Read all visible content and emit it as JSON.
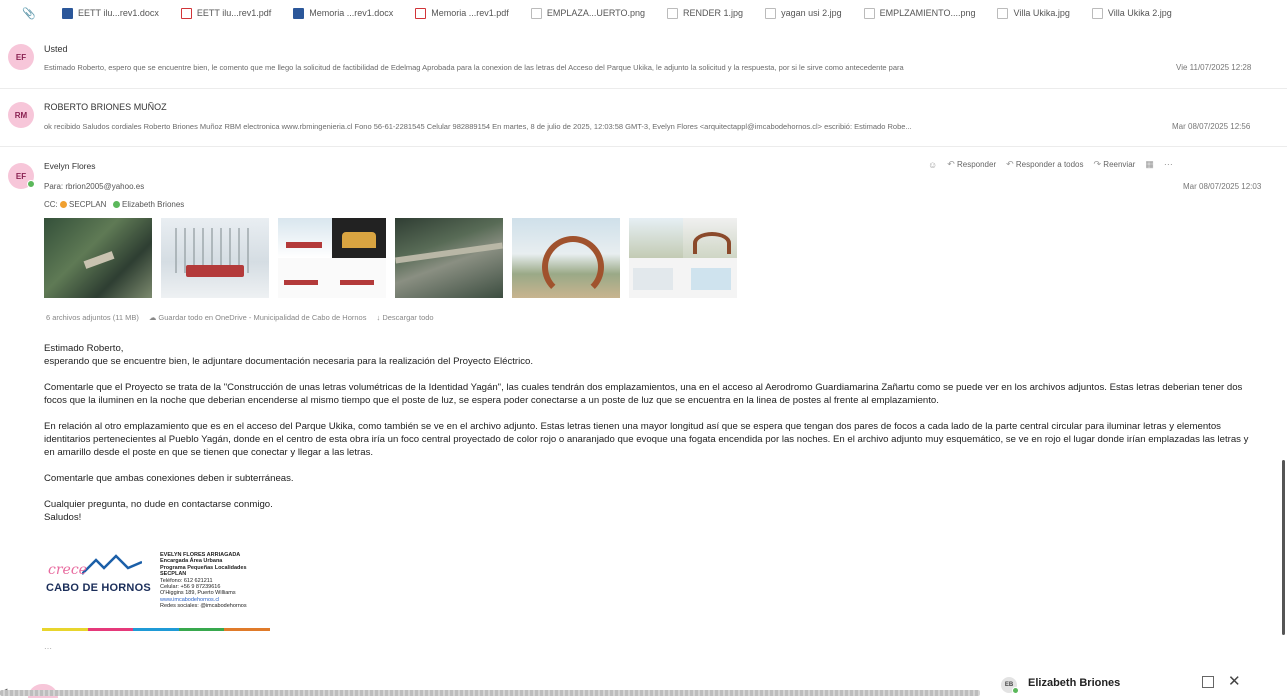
{
  "attachments": [
    {
      "name": "EETT ilu...rev1.docx",
      "type": "docx"
    },
    {
      "name": "EETT ilu...rev1.pdf",
      "type": "pdf"
    },
    {
      "name": "Memoria ...rev1.docx",
      "type": "docx"
    },
    {
      "name": "Memoria ...rev1.pdf",
      "type": "pdf"
    },
    {
      "name": "EMPLAZA...UERTO.png",
      "type": "img"
    },
    {
      "name": "RENDER 1.jpg",
      "type": "img"
    },
    {
      "name": "yagan usi 2.jpg",
      "type": "img"
    },
    {
      "name": "EMPLZAMIENTO....png",
      "type": "img"
    },
    {
      "name": "Villa Ukika.jpg",
      "type": "img"
    },
    {
      "name": "Villa Ukika 2.jpg",
      "type": "img"
    }
  ],
  "messages": [
    {
      "initials": "EF",
      "sender": "Usted",
      "snippet": "Estimado Roberto, espero que se encuentre bien, le comento que me llego la solicitud de factibilidad de Edelmag Aprobada para la conexion de las letras del Acceso del Parque Ukika, le adjunto la solicitud y la respuesta, por si le sirve como antecedente para",
      "date": "Vie 11/07/2025 12:28"
    },
    {
      "initials": "RM",
      "sender": "ROBERTO BRIONES MUÑOZ",
      "snippet": "ok recibido Saludos cordiales Roberto Briones Muñoz RBM electronica www.rbmingenieria.cl Fono 56-61-2281545 Celular 982889154 En martes, 8 de julio de 2025, 12:03:58 GMT-3, Evelyn Flores <arquitectappl@imcabodehornos.cl> escribió: Estimado Robe...",
      "date": "Mar 08/07/2025 12:56"
    }
  ],
  "open_message": {
    "initials": "EF",
    "sender": "Evelyn Flores",
    "to_label": "Para:",
    "to": "rbrion2005@yahoo.es",
    "cc_label": "CC:",
    "cc": [
      "SECPLAN",
      "Elizabeth Briones"
    ],
    "date": "Mar 08/07/2025 12:03",
    "actions": {
      "reply": "Responder",
      "reply_all": "Responder a todos",
      "forward": "Reenviar"
    },
    "attachment_count": "6 archivos adjuntos (11 MB)",
    "save_onedrive": "Guardar todo en OneDrive - Municipalidad de Cabo de Hornos",
    "download_all": "Descargar todo",
    "body": {
      "greeting": "Estimado Roberto,",
      "p1": "esperando que se encuentre bien, le adjuntare documentación necesaria para la realización del Proyecto Eléctrico.",
      "p2": "Comentarle que el Proyecto se trata de la \"Construcción de unas letras volumétricas de la Identidad Yagán\", las cuales tendrán dos emplazamientos, una en el acceso al Aerodromo Guardiamarina Zañartu como se puede ver en los archivos adjuntos. Estas letras deberian tener dos focos que la iluminen en la noche que deberian encenderse al mismo tiempo que el poste de luz, se espera poder conectarse a un poste de luz que se encuentra en la linea de postes al frente al emplazamiento.",
      "p3": "En relación al otro emplazamiento que es en el acceso del Parque Ukika, como también se ve en el archivo adjunto. Estas letras tienen una mayor longitud así que se espera que tengan dos pares de focos a cada lado de la parte central circular para iluminar letras y elementos identitarios pertenecientes al Pueblo Yagán, donde en el centro de esta obra iría un foco central proyectado de color rojo o anaranjado que evoque una fogata encendida por las noches. En el archivo adjunto muy esquemático, se ve en rojo el lugar donde irían emplazadas las letras y en amarillo desde el poste en que se tienen que conectar y llegar a las letras.",
      "p4": "Comentarle que ambas conexiones deben ir subterráneas.",
      "p5": "Cualquier pregunta, no dude en contactarse conmigo.",
      "closing": "Saludos!"
    },
    "signature": {
      "script": "crece",
      "logo": "CABO DE HORNOS",
      "name": "EVELYN FLORES ARRIAGADA",
      "role": "Encargada Área Urbana",
      "program": "Programa Pequeñas Localidades",
      "dept": "SECPLAN",
      "phone": "Teléfono: 612 621211",
      "cell": "Celular: +56 9 87239616",
      "address": "O'Higgins 189, Puerto Williams",
      "web": "www.imcabodehornos.cl",
      "social": "Redes sociales: @imcabodehornos"
    }
  },
  "chat": {
    "initials": "EB",
    "name": "Elizabeth Briones"
  },
  "colors": {
    "avatar_bg": "#f7c6d9",
    "presence": "#5bb85b",
    "stripe": [
      "#e8d52d",
      "#e5397a",
      "#1f9ad6",
      "#38a84e",
      "#e07b2a"
    ]
  }
}
